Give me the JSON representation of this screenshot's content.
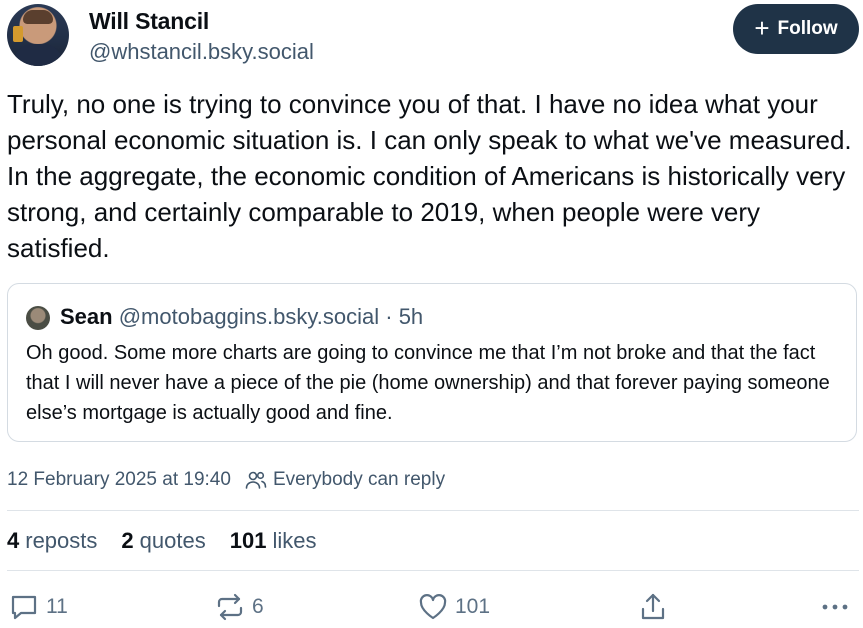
{
  "author": {
    "name": "Will Stancil",
    "handle": "@whstancil.bsky.social"
  },
  "follow_button": {
    "icon": "plus-icon",
    "label": "Follow"
  },
  "post": {
    "text": "Truly, no one is trying to convince you of that. I have no idea what your personal economic situation is. I can only speak to what we've measured. In the aggregate, the economic condition of Americans is historically very strong, and certainly comparable to 2019, when people were very satisfied."
  },
  "quoted_post": {
    "author_name": "Sean",
    "author_handle": "@motobaggins.bsky.social",
    "separator": "·",
    "time": "5h",
    "text": "Oh good. Some more charts are going to convince me that I’m not broke and that the fact that I will never have a piece of the pie (home ownership) and that forever paying someone else’s mortgage is actually good and fine."
  },
  "meta": {
    "timestamp": "12 February 2025 at 19:40",
    "reply_setting": "Everybody can reply"
  },
  "stats": {
    "reposts_count": "4",
    "reposts_label": "reposts",
    "quotes_count": "2",
    "quotes_label": "quotes",
    "likes_count": "101",
    "likes_label": "likes"
  },
  "actions": {
    "replies": "11",
    "reposts": "6",
    "likes": "101"
  },
  "colors": {
    "follow_bg": "#1f3347",
    "text": "#0b0f14",
    "secondary_text": "#42576c",
    "icon": "#5d7185",
    "border": "#d4dbe2"
  }
}
